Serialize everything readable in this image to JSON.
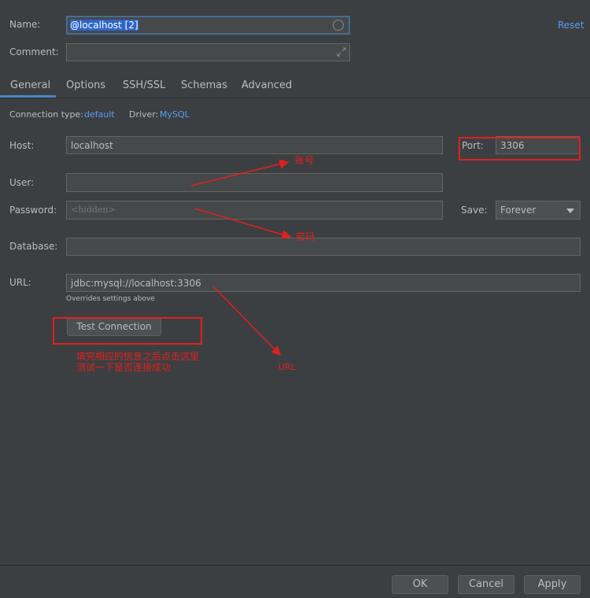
{
  "header": {
    "name_label": "Name:",
    "name_value": "@localhost [2]",
    "comment_label": "Comment:",
    "comment_value": "",
    "reset_label": "Reset"
  },
  "tabs": [
    {
      "label": "General",
      "active": true
    },
    {
      "label": "Options"
    },
    {
      "label": "SSH/SSL"
    },
    {
      "label": "Schemas"
    },
    {
      "label": "Advanced"
    }
  ],
  "connection": {
    "type_label": "Connection type:",
    "type_value": "default",
    "driver_label": "Driver:",
    "driver_value": "MySQL"
  },
  "form": {
    "host_label": "Host:",
    "host_value": "localhost",
    "port_label": "Port:",
    "port_value": "3306",
    "user_label": "User:",
    "user_value": "",
    "password_label": "Password:",
    "password_placeholder": "<hidden>",
    "save_label": "Save:",
    "save_value": "Forever",
    "database_label": "Database:",
    "database_value": "",
    "url_label": "URL:",
    "url_value": "jdbc:mysql://localhost:3306",
    "url_hint": "Overrides settings above",
    "test_connection_label": "Test Connection"
  },
  "annotations": {
    "account": "账号",
    "password": "密码",
    "url": "URL",
    "test_line1": "填完相应的信息之后点击这里",
    "test_line2": "测试一下是否连接成功"
  },
  "footer": {
    "ok_label": "OK",
    "cancel_label": "Cancel",
    "apply_label": "Apply"
  },
  "colors": {
    "background": "#3c3f41",
    "link": "#589df6",
    "selection": "#2f65ca",
    "annotation": "#e02020"
  }
}
